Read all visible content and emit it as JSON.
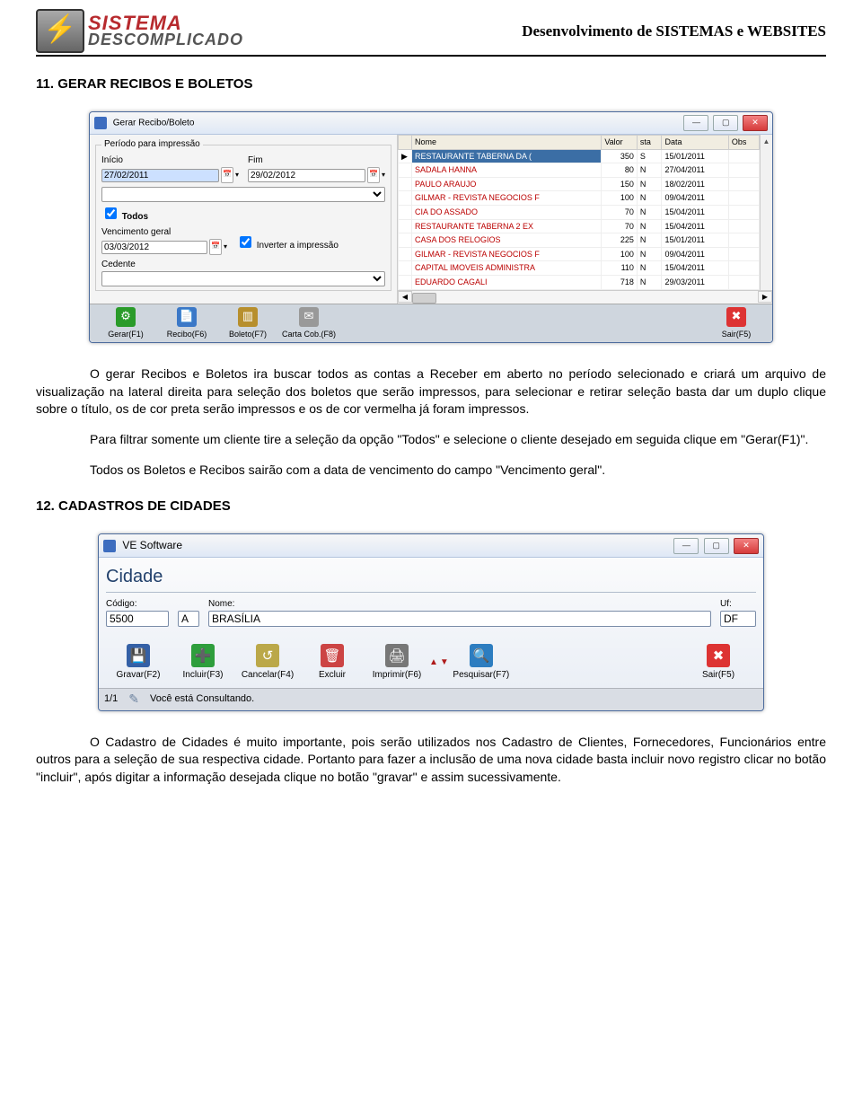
{
  "header": {
    "logo_line1": "SISTEMA",
    "logo_line2": "DESCOMPLICADO",
    "tagline": "Desenvolvimento de SISTEMAS e WEBSITES"
  },
  "sections": {
    "s1_title": "11. GERAR RECIBOS E BOLETOS",
    "s2_title": "12. CADASTROS DE CIDADES"
  },
  "paragraphs": {
    "p1": "O gerar Recibos e Boletos ira buscar todos as contas a Receber em aberto no período selecionado e criará um arquivo de visualização na lateral direita para seleção dos boletos que serão impressos, para selecionar e retirar seleção basta dar um duplo clique sobre o título, os de cor preta serão impressos e os de cor vermelha já foram impressos.",
    "p2": "Para filtrar somente um cliente tire a seleção da opção \"Todos\" e selecione o cliente desejado em seguida clique em \"Gerar(F1)\".",
    "p3": "Todos os Boletos e Recibos sairão com a data de vencimento do campo \"Vencimento geral\".",
    "p4": "O Cadastro de Cidades é muito importante, pois serão utilizados nos Cadastro de Clientes, Fornecedores, Funcionários entre outros para a seleção de sua respectiva cidade. Portanto para fazer a inclusão de uma nova cidade basta incluir novo registro clicar no botão \"incluir\", após digitar a informação desejada clique no botão \"gravar\" e assim sucessivamente."
  },
  "win1": {
    "title": "Gerar Recibo/Boleto",
    "group": "Período para impressão",
    "inicio_label": "Início",
    "inicio_value": "27/02/2011",
    "fim_label": "Fim",
    "fim_value": "29/02/2012",
    "todos_label": "Todos",
    "venc_label": "Vencimento geral",
    "venc_value": "03/03/2012",
    "inverter_label": "Inverter a impressão",
    "cedente_label": "Cedente",
    "columns": [
      "Nome",
      "Valor",
      "sta",
      "Data",
      "Obs"
    ],
    "rows": [
      {
        "nome": "RESTAURANTE TABERNA DA (",
        "valor": "350",
        "sta": "S",
        "data": "15/01/2011",
        "red": false
      },
      {
        "nome": "SADALA HANNA",
        "valor": "80",
        "sta": "N",
        "data": "27/04/2011",
        "red": true
      },
      {
        "nome": "PAULO ARAUJO",
        "valor": "150",
        "sta": "N",
        "data": "18/02/2011",
        "red": true
      },
      {
        "nome": "GILMAR - REVISTA NEGOCIOS F",
        "valor": "100",
        "sta": "N",
        "data": "09/04/2011",
        "red": true
      },
      {
        "nome": "CIA DO ASSADO",
        "valor": "70",
        "sta": "N",
        "data": "15/04/2011",
        "red": true
      },
      {
        "nome": "RESTAURANTE TABERNA 2 EX",
        "valor": "70",
        "sta": "N",
        "data": "15/04/2011",
        "red": true
      },
      {
        "nome": "CASA DOS RELOGIOS",
        "valor": "225",
        "sta": "N",
        "data": "15/01/2011",
        "red": true
      },
      {
        "nome": "GILMAR - REVISTA NEGOCIOS F",
        "valor": "100",
        "sta": "N",
        "data": "09/04/2011",
        "red": true
      },
      {
        "nome": "CAPITAL IMOVEIS ADMINISTRA",
        "valor": "110",
        "sta": "N",
        "data": "15/04/2011",
        "red": true
      },
      {
        "nome": "EDUARDO CAGALI",
        "valor": "718",
        "sta": "N",
        "data": "29/03/2011",
        "red": true
      }
    ],
    "buttons": {
      "gerar": "Gerar(F1)",
      "recibo": "Recibo(F6)",
      "boleto": "Boleto(F7)",
      "carta": "Carta Cob.(F8)",
      "sair": "Sair(F5)"
    }
  },
  "win2": {
    "title": "VE Software",
    "form_title": "Cidade",
    "codigo_label": "Código:",
    "codigo_value": "5500",
    "codigo_extra": "A",
    "nome_label": "Nome:",
    "nome_value": "BRASÍLIA",
    "uf_label": "Uf:",
    "uf_value": "DF",
    "buttons": {
      "gravar": "Gravar(F2)",
      "incluir": "Incluir(F3)",
      "cancelar": "Cancelar(F4)",
      "excluir": "Excluir",
      "imprimir": "Imprimir(F6)",
      "pesquisar": "Pesquisar(F7)",
      "sair": "Sair(F5)"
    },
    "status_pos": "1/1",
    "status_msg": "Você está Consultando."
  }
}
